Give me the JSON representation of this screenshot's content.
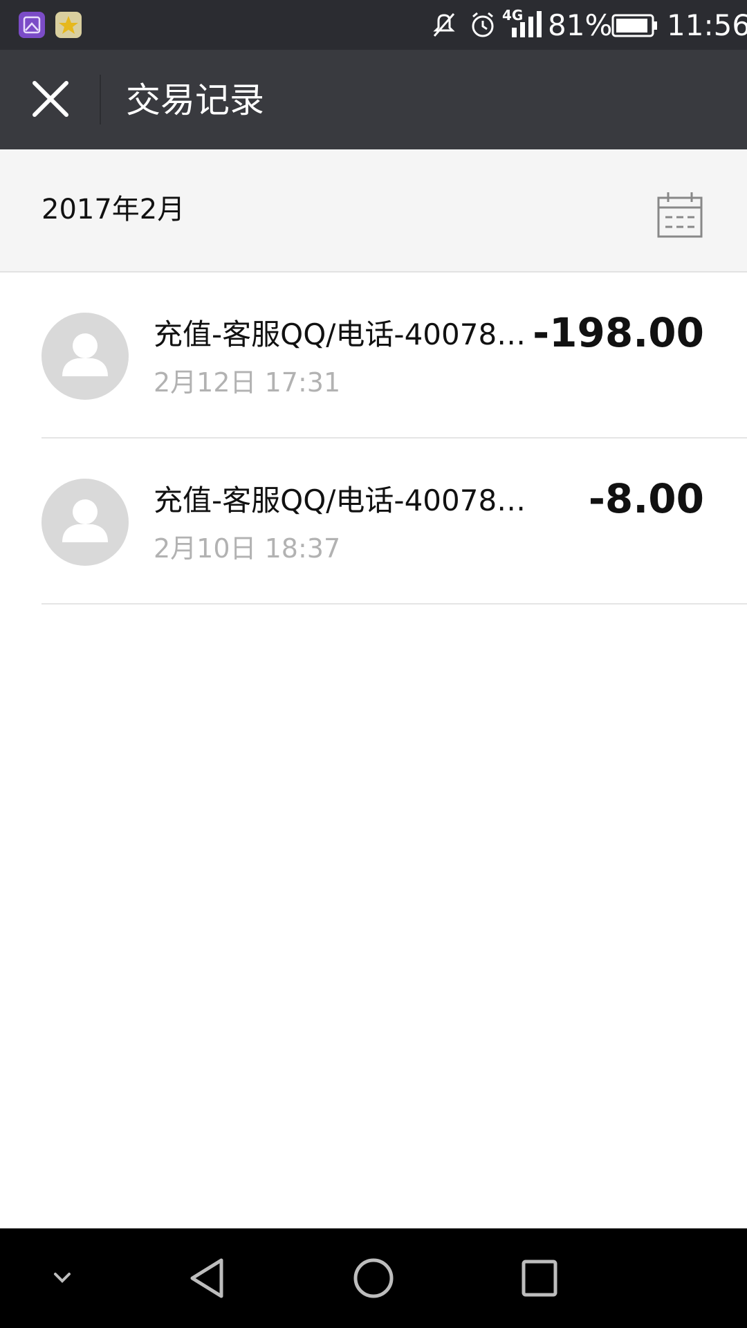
{
  "status_bar": {
    "signal_label": "4G",
    "battery": "81%",
    "time": "11:56"
  },
  "header": {
    "title": "交易记录"
  },
  "month": {
    "label": "2017年2月"
  },
  "transactions": [
    {
      "title": "充值-客服QQ/电话-40078…",
      "time": "2月12日 17:31",
      "amount": "-198.00"
    },
    {
      "title": "充值-客服QQ/电话-40078…",
      "time": "2月10日 18:37",
      "amount": "-8.00"
    }
  ],
  "icons": {
    "close": "close-icon",
    "calendar": "calendar-icon",
    "avatar": "person-icon",
    "nav_down": "chevron-down-icon",
    "nav_back": "back-triangle-icon",
    "nav_home": "home-circle-icon",
    "nav_recent": "recent-square-icon"
  },
  "colors": {
    "status_bar_bg": "#2b2c31",
    "title_bar_bg": "#393a3f",
    "month_header_bg": "#f5f5f5",
    "secondary_text": "#b2b2b2"
  }
}
